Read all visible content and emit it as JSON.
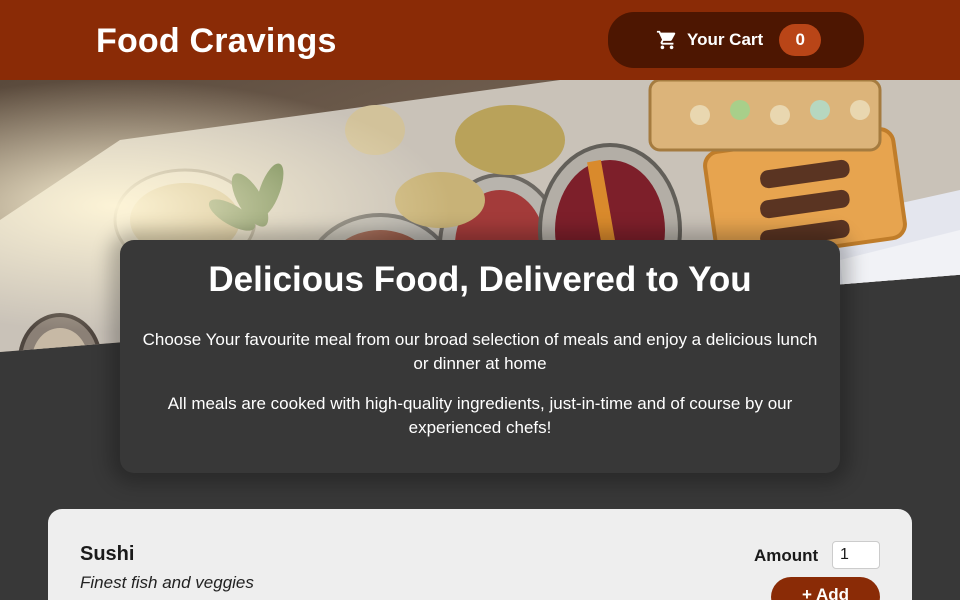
{
  "header": {
    "title": "Food Cravings",
    "cart": {
      "icon": "cart-icon",
      "label": "Your Cart",
      "count": "0"
    }
  },
  "summary": {
    "heading": "Delicious Food, Delivered to You",
    "paragraphs": [
      "Choose Your favourite meal from our broad selection of meals and enjoy a delicious lunch or dinner at home",
      "All meals are cooked with high-quality ingredients, just-in-time and of course by our experienced chefs!"
    ]
  },
  "meals": [
    {
      "name": "Sushi",
      "description": "Finest fish and veggies",
      "amount_label": "Amount",
      "amount_value": "1",
      "add_label": "+ Add"
    }
  ],
  "colors": {
    "header": "#8a2b06",
    "cart_button": "#4d1601",
    "badge": "#b94517",
    "background": "#383838",
    "card": "#eeeeee"
  }
}
